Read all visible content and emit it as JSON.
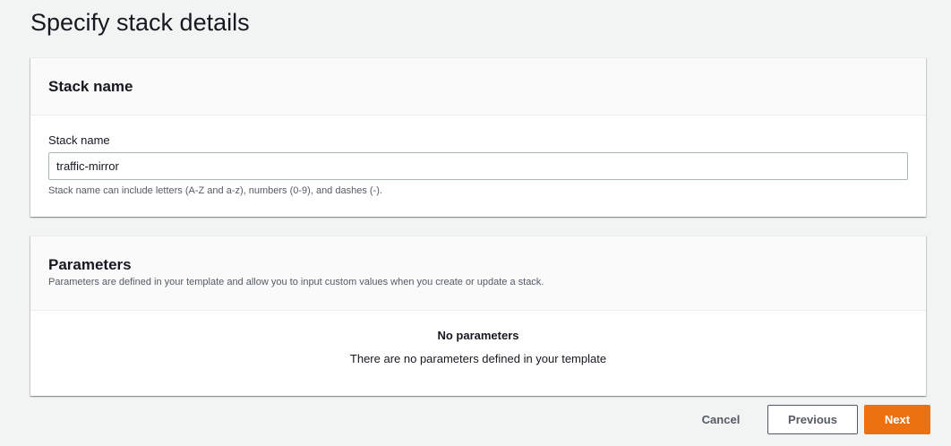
{
  "page": {
    "title": "Specify stack details"
  },
  "stack_name_panel": {
    "heading": "Stack name",
    "field_label": "Stack name",
    "field_value": "traffic-mirror",
    "hint": "Stack name can include letters (A-Z and a-z), numbers (0-9), and dashes (-)."
  },
  "parameters_panel": {
    "heading": "Parameters",
    "description": "Parameters are defined in your template and allow you to input custom values when you create or update a stack.",
    "empty_title": "No parameters",
    "empty_description": "There are no parameters defined in your template"
  },
  "footer": {
    "cancel_label": "Cancel",
    "previous_label": "Previous",
    "next_label": "Next"
  },
  "colors": {
    "primary_button": "#ec7211",
    "background": "#f2f3f3",
    "text": "#16191f",
    "secondary_text": "#545b64"
  }
}
